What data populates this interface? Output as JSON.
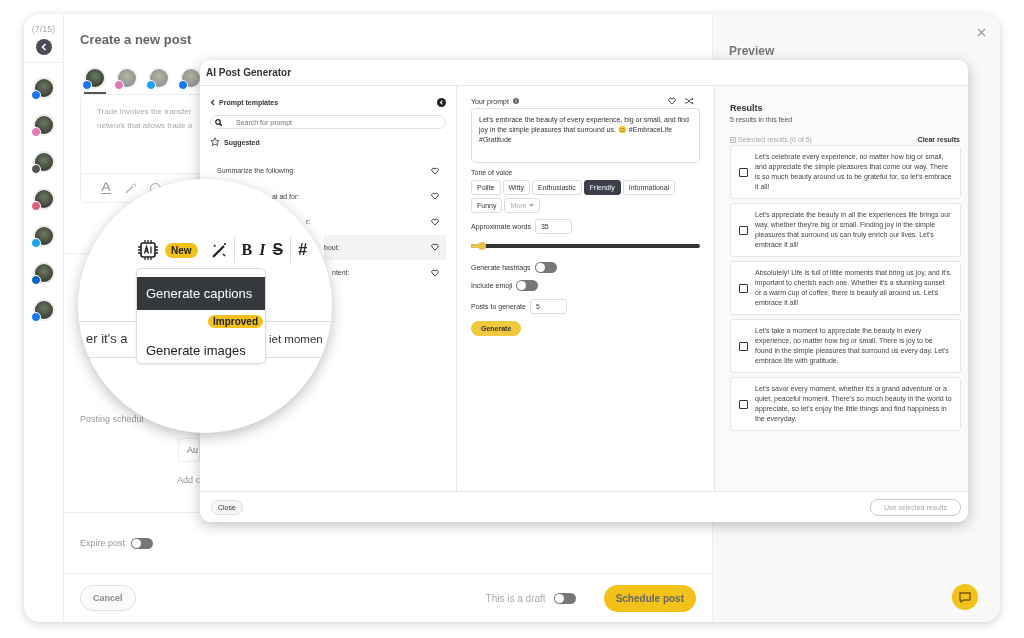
{
  "sidebar": {
    "counter": "(7/15)",
    "accounts": [
      {
        "color": "#1877f2"
      },
      {
        "color": "#e07bb8"
      },
      {
        "color": "#555555"
      },
      {
        "color": "#e0607a"
      },
      {
        "color": "#1da1f2"
      },
      {
        "color": "#0a66c2"
      },
      {
        "color": "#1877f2"
      }
    ]
  },
  "editor": {
    "title": "Create a new post",
    "accounts": [
      {
        "selected": true,
        "color": "#1877f2"
      },
      {
        "selected": false,
        "color": "#e07bb8"
      },
      {
        "selected": false,
        "color": "#1da1f2"
      },
      {
        "selected": false,
        "color": "#1877f2"
      }
    ],
    "text_lines": [
      "Trade involves the transfer",
      "network that allows trade a"
    ],
    "schedule_label": "Posting schedul",
    "schedule_field": "Au",
    "add_link": "Add c",
    "expire": {
      "label": "Expire post",
      "on": false
    }
  },
  "preview": {
    "title": "Preview"
  },
  "footer": {
    "cancel": "Cancel",
    "draft": {
      "label": "This is a draft",
      "on": false
    },
    "schedule": "Schedule post"
  },
  "modal": {
    "title": "AI Post Generator",
    "templates": {
      "title": "Prompt templates",
      "search_placeholder": "Search for prompt",
      "section": "Suggested",
      "items": [
        {
          "label": "Summarize the following:",
          "selected": false
        },
        {
          "label": "al ad for:",
          "selected": false
        },
        {
          "label": "r:",
          "selected": false
        },
        {
          "label": "bout:",
          "selected": true
        },
        {
          "label": "ntent:",
          "selected": false
        }
      ]
    },
    "prompt": {
      "label": "Your prompt",
      "value": "Let's embrace the beauty of every experience, big or small, and find joy in the simple pleasures that surround us. 😊 #EmbraceLife #Gratitude",
      "tone_label": "Tone of voice",
      "tones": [
        {
          "label": "Polite",
          "kind": "option",
          "selected": false
        },
        {
          "label": "Witty",
          "kind": "option",
          "selected": false
        },
        {
          "label": "Enthusiastic",
          "kind": "option",
          "selected": false
        },
        {
          "label": "Friendly",
          "kind": "option",
          "selected": true
        },
        {
          "label": "Informational",
          "kind": "option",
          "selected": false
        },
        {
          "label": "Funny",
          "kind": "option",
          "selected": false
        },
        {
          "label": "More",
          "kind": "dropdown",
          "selected": false
        }
      ],
      "words_label": "Approximate words",
      "words_value": "35",
      "words_slider": {
        "level": 0.05
      },
      "hashtags": {
        "label": "Generate hashtags",
        "on": false
      },
      "emoji": {
        "label": "Include emoji",
        "on": false
      },
      "posts_label": "Posts to generate",
      "posts_value": "5",
      "generate": "Generate"
    },
    "results": {
      "title": "Results",
      "subtitle": "5 results in this feed",
      "selected_label": "Selected results (0 of 5)",
      "clear": "Clear results",
      "items": [
        {
          "text": "Let's celebrate every experience, no matter how big or small, and appreciate the simple pleasures that come our way. There is so much beauty around us to be grateful for, so let's embrace it all!",
          "checked": false
        },
        {
          "text": "Let's appreciate the beauty in all the experiences life brings our way, whether they're big or small. Finding joy in the simple pleasures that surround us can truly enrich our lives. Let's embrace it all!",
          "checked": false
        },
        {
          "text": "Absolutely! Life is full of little moments that bring us joy, and it's important to cherish each one. Whether it's a stunning sunset or a warm cup of coffee, there is beauty all around us. Let's embrace it all!",
          "checked": false
        },
        {
          "text": "Let's take a moment to appreciate the beauty in every experience, no matter how big or small. There is joy to be found in the simple pleasures that surround us every day. Let's embrace life with gratitude.",
          "checked": false
        },
        {
          "text": "Let's savor every moment, whether it's a grand adventure or a quiet, peaceful moment. There's so much beauty in the world to appreciate, so let's enjoy the little things and find happiness in the everyday.",
          "checked": false
        }
      ]
    },
    "close": "Close",
    "use_selected": {
      "label": "Use selected results",
      "disabled": true
    }
  },
  "magnifier": {
    "ai_badge": "New",
    "format_buttons": [
      {
        "label": "B",
        "kind": "bold"
      },
      {
        "label": "I",
        "kind": "italic"
      },
      {
        "label": "S",
        "kind": "strike"
      },
      {
        "label": "#",
        "kind": "hashtag"
      }
    ],
    "behind_left": "er it's a",
    "behind_right": "iet momen",
    "menu": [
      {
        "label": "Generate captions",
        "selected": true
      },
      {
        "label": "Generate images",
        "selected": false,
        "badge": "Improved"
      }
    ]
  }
}
